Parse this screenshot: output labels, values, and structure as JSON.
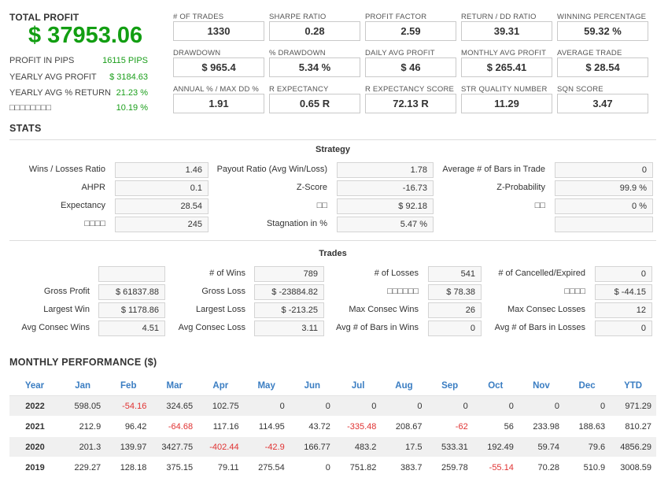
{
  "summary": {
    "total_profit_label": "TOTAL PROFIT",
    "total_profit_value": "$ 37953.06",
    "rows": [
      {
        "label": "PROFIT IN PIPS",
        "value": "16115 PIPS"
      },
      {
        "label": "YEARLY AVG PROFIT",
        "value": "$ 3184.63"
      },
      {
        "label": "YEARLY AVG % RETURN",
        "value": "21.23 %"
      },
      {
        "label": "□□□□□□□□",
        "value": "10.19 %"
      }
    ]
  },
  "metrics": [
    {
      "label": "# OF TRADES",
      "value": "1330"
    },
    {
      "label": "SHARPE RATIO",
      "value": "0.28"
    },
    {
      "label": "PROFIT FACTOR",
      "value": "2.59"
    },
    {
      "label": "RETURN / DD RATIO",
      "value": "39.31"
    },
    {
      "label": "WINNING PERCENTAGE",
      "value": "59.32 %"
    },
    {
      "label": "DRAWDOWN",
      "value": "$ 965.4"
    },
    {
      "label": "% DRAWDOWN",
      "value": "5.34 %"
    },
    {
      "label": "DAILY AVG PROFIT",
      "value": "$ 46"
    },
    {
      "label": "MONTHLY AVG PROFIT",
      "value": "$ 265.41"
    },
    {
      "label": "AVERAGE TRADE",
      "value": "$ 28.54"
    },
    {
      "label": "ANNUAL % / MAX DD %",
      "value": "1.91"
    },
    {
      "label": "R EXPECTANCY",
      "value": "0.65 R"
    },
    {
      "label": "R EXPECTANCY SCORE",
      "value": "72.13 R"
    },
    {
      "label": "STR QUALITY NUMBER",
      "value": "11.29"
    },
    {
      "label": "SQN SCORE",
      "value": "3.47"
    }
  ],
  "stats": {
    "title": "STATS",
    "strategy_heading": "Strategy",
    "strategy": [
      [
        {
          "label": "Wins / Losses Ratio",
          "value": "1.46"
        },
        {
          "label": "Payout Ratio (Avg Win/Loss)",
          "value": "1.78"
        },
        {
          "label": "Average # of Bars in Trade",
          "value": "0"
        }
      ],
      [
        {
          "label": "AHPR",
          "value": "0.1"
        },
        {
          "label": "Z-Score",
          "value": "-16.73"
        },
        {
          "label": "Z-Probability",
          "value": "99.9 %"
        }
      ],
      [
        {
          "label": "Expectancy",
          "value": "28.54"
        },
        {
          "label": "□□",
          "value": "$ 92.18"
        },
        {
          "label": "□□",
          "value": "0 %"
        }
      ],
      [
        {
          "label": "□□□□",
          "value": "245"
        },
        {
          "label": "Stagnation in %",
          "value": "5.47 %"
        },
        {
          "label": "",
          "value": ""
        }
      ]
    ],
    "trades_heading": "Trades",
    "trades": [
      [
        {
          "label": "",
          "value": ""
        },
        {
          "label": "# of Wins",
          "value": "789"
        },
        {
          "label": "# of Losses",
          "value": "541"
        },
        {
          "label": "# of Cancelled/Expired",
          "value": "0"
        }
      ],
      [
        {
          "label": "Gross Profit",
          "value": "$ 61837.88"
        },
        {
          "label": "Gross Loss",
          "value": "$ -23884.82"
        },
        {
          "label": "□□□□□□",
          "value": "$ 78.38"
        },
        {
          "label": "□□□□",
          "value": "$ -44.15"
        }
      ],
      [
        {
          "label": "Largest Win",
          "value": "$ 1178.86"
        },
        {
          "label": "Largest Loss",
          "value": "$ -213.25"
        },
        {
          "label": "Max Consec Wins",
          "value": "26"
        },
        {
          "label": "Max Consec Losses",
          "value": "12"
        }
      ],
      [
        {
          "label": "Avg Consec Wins",
          "value": "4.51"
        },
        {
          "label": "Avg Consec Loss",
          "value": "3.11"
        },
        {
          "label": "Avg # of Bars in Wins",
          "value": "0"
        },
        {
          "label": "Avg # of Bars in Losses",
          "value": "0"
        }
      ]
    ]
  },
  "monthly": {
    "title": "MONTHLY PERFORMANCE ($)",
    "headers": [
      "Year",
      "Jan",
      "Feb",
      "Mar",
      "Apr",
      "May",
      "Jun",
      "Jul",
      "Aug",
      "Sep",
      "Oct",
      "Nov",
      "Dec",
      "YTD"
    ],
    "rows": [
      [
        "2022",
        "598.05",
        "-54.16",
        "324.65",
        "102.75",
        "0",
        "0",
        "0",
        "0",
        "0",
        "0",
        "0",
        "0",
        "971.29"
      ],
      [
        "2021",
        "212.9",
        "96.42",
        "-64.68",
        "117.16",
        "114.95",
        "43.72",
        "-335.48",
        "208.67",
        "-62",
        "56",
        "233.98",
        "188.63",
        "810.27"
      ],
      [
        "2020",
        "201.3",
        "139.97",
        "3427.75",
        "-402.44",
        "-42.9",
        "166.77",
        "483.2",
        "17.5",
        "533.31",
        "192.49",
        "59.74",
        "79.6",
        "4856.29"
      ],
      [
        "2019",
        "229.27",
        "128.18",
        "375.15",
        "79.11",
        "275.54",
        "0",
        "751.82",
        "383.7",
        "259.78",
        "-55.14",
        "70.28",
        "510.9",
        "3008.59"
      ]
    ]
  },
  "colors": {
    "profit_green": "#129e12",
    "negative_red": "#e03232",
    "header_blue": "#3a7dc2"
  }
}
